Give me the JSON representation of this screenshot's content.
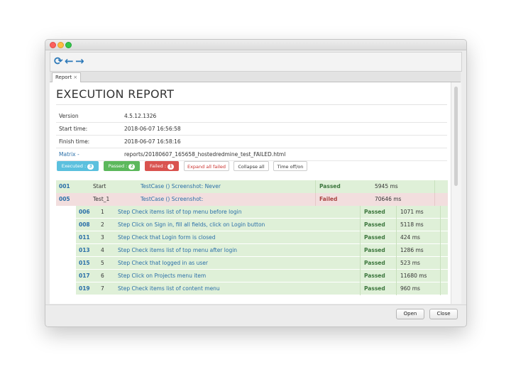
{
  "toolbar": {
    "refresh_icon": "refresh-icon",
    "back_icon": "arrow-left-icon",
    "forward_icon": "arrow-right-icon"
  },
  "tab": {
    "label": "Report",
    "close": "×"
  },
  "report": {
    "title": "EXECUTION REPORT",
    "info": [
      {
        "label": "Version",
        "value": "4.5.12.1326"
      },
      {
        "label": "Start time:",
        "value": "2018-06-07 16:56:58"
      },
      {
        "label": "Finish time:",
        "value": "2018-06-07 16:58:16"
      },
      {
        "label": "Matrix -",
        "value": "reports/20180607_165658_hostedredmine_test_FAILED.html"
      }
    ]
  },
  "filters": {
    "executed": {
      "label": "Executed :",
      "count": "3"
    },
    "passed": {
      "label": "Passed :",
      "count": "2"
    },
    "failed": {
      "label": "Failed :",
      "count": "1"
    },
    "expand_all_failed": "Expand all failed",
    "collapse_all": "Collapse all",
    "time_toggle": "Time off/on"
  },
  "testcases": [
    {
      "id": "001",
      "name": "Start",
      "description": "TestCase () Screenshot: Never",
      "status": "Passed",
      "time": "5945 ms"
    },
    {
      "id": "005",
      "name": "Test_1",
      "description": "TestCase () Screenshot:",
      "status": "Failed",
      "time": "70646 ms"
    }
  ],
  "steps": [
    {
      "id": "006",
      "num": "1",
      "description": "Step Check items list of top menu before login",
      "status": "Passed",
      "time": "1071 ms"
    },
    {
      "id": "008",
      "num": "2",
      "description": "Step Click on Sign in, fill all fields, click on Login button",
      "status": "Passed",
      "time": "5118 ms"
    },
    {
      "id": "011",
      "num": "3",
      "description": "Step Check that Login form is closed",
      "status": "Passed",
      "time": "424 ms"
    },
    {
      "id": "013",
      "num": "4",
      "description": "Step Check items list of top menu after login",
      "status": "Passed",
      "time": "1286 ms"
    },
    {
      "id": "015",
      "num": "5",
      "description": "Step Check that logged in as user",
      "status": "Passed",
      "time": "523 ms"
    },
    {
      "id": "017",
      "num": "6",
      "description": "Step Click on Projects menu item",
      "status": "Passed",
      "time": "11680 ms"
    },
    {
      "id": "019",
      "num": "7",
      "description": "Step Check items list of content menu",
      "status": "Passed",
      "time": "960 ms"
    }
  ],
  "dialog": {
    "open_label": "Open",
    "close_label": "Close"
  },
  "colors": {
    "pass_bg": "#dff0d8",
    "fail_bg": "#f2dede",
    "info": "#5bc0de",
    "success": "#5cb85c",
    "danger": "#d9534f",
    "link": "#2a6fa8"
  }
}
